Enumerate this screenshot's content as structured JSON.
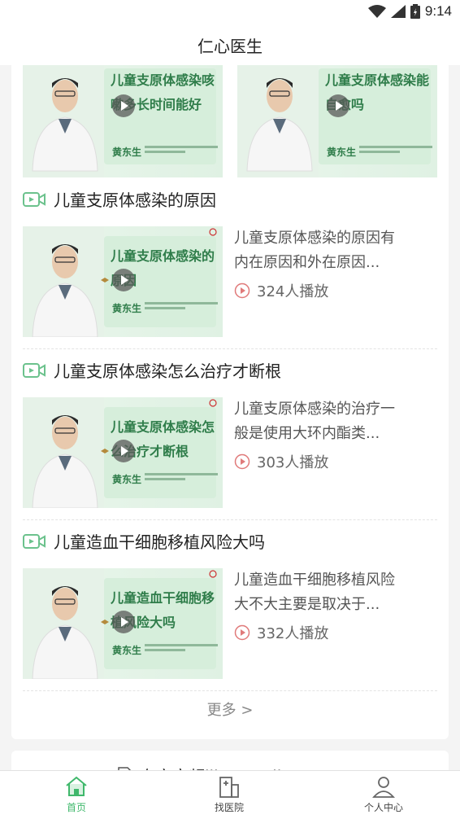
{
  "status_bar": {
    "time": "9:14"
  },
  "header": {
    "title": "仁心医生"
  },
  "top_row": [
    {
      "thumb_title": "儿童支原体感染咳嗽多长时间能好",
      "doctor_name": "黄东生"
    },
    {
      "thumb_title": "儿童支原体感染能自愈吗",
      "doctor_name": "黄东生"
    }
  ],
  "videos": [
    {
      "title": "儿童支原体感染的原因",
      "thumb_title": "儿童支原体感染的原因",
      "doctor_name": "黄东生",
      "desc_line1": "儿童支原体感染的原因有",
      "desc_line2": "内在原因和外在原因...",
      "plays": "324人播放"
    },
    {
      "title": "儿童支原体感染怎么治疗才断根",
      "thumb_title": "儿童支原体感染怎么治疗才断根",
      "doctor_name": "黄东生",
      "desc_line1": "儿童支原体感染的治疗一",
      "desc_line2": "般是使用大环内酯类...",
      "plays": "303人播放"
    },
    {
      "title": "儿童造血干细胞移植风险大吗",
      "thumb_title": "儿童造血干细胞移植风险大吗",
      "doctor_name": "黄东生",
      "desc_line1": "儿童造血干细胞移植风险",
      "desc_line2": "大不大主要是取决于...",
      "plays": "332人播放"
    }
  ],
  "more_label": "更多 >",
  "next_section": {
    "title": "专家音频likes audio"
  },
  "bottom_nav": [
    {
      "label": "首页",
      "icon": "home-icon",
      "active": true
    },
    {
      "label": "找医院",
      "icon": "hospital-icon",
      "active": false
    },
    {
      "label": "个人中心",
      "icon": "user-icon",
      "active": false
    }
  ],
  "colors": {
    "accent": "#3fb86b",
    "play_badge": "#e07a7a",
    "thumb_green": "#2f7d4a"
  }
}
